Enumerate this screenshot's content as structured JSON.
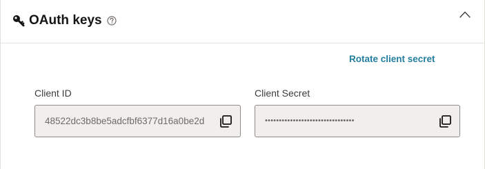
{
  "section": {
    "title": "OAuth keys",
    "icons": {
      "key": "key-icon",
      "help": "help-icon",
      "collapse": "chevron-up-icon"
    }
  },
  "actions": {
    "rotate_label": "Rotate client secret"
  },
  "client_id": {
    "label": "Client ID",
    "value": "48522dc3b8be5adcfbf6377d16a0be2d",
    "copy_icon": "copy-icon"
  },
  "client_secret": {
    "label": "Client Secret",
    "value": "••••••••••••••••••••••••••••••••",
    "copy_icon": "copy-icon"
  },
  "colors": {
    "link": "#227e9e",
    "field_background": "#f1efed",
    "field_border": "#8e8a85",
    "text_primary": "#161513",
    "text_muted": "#6f6b66"
  }
}
